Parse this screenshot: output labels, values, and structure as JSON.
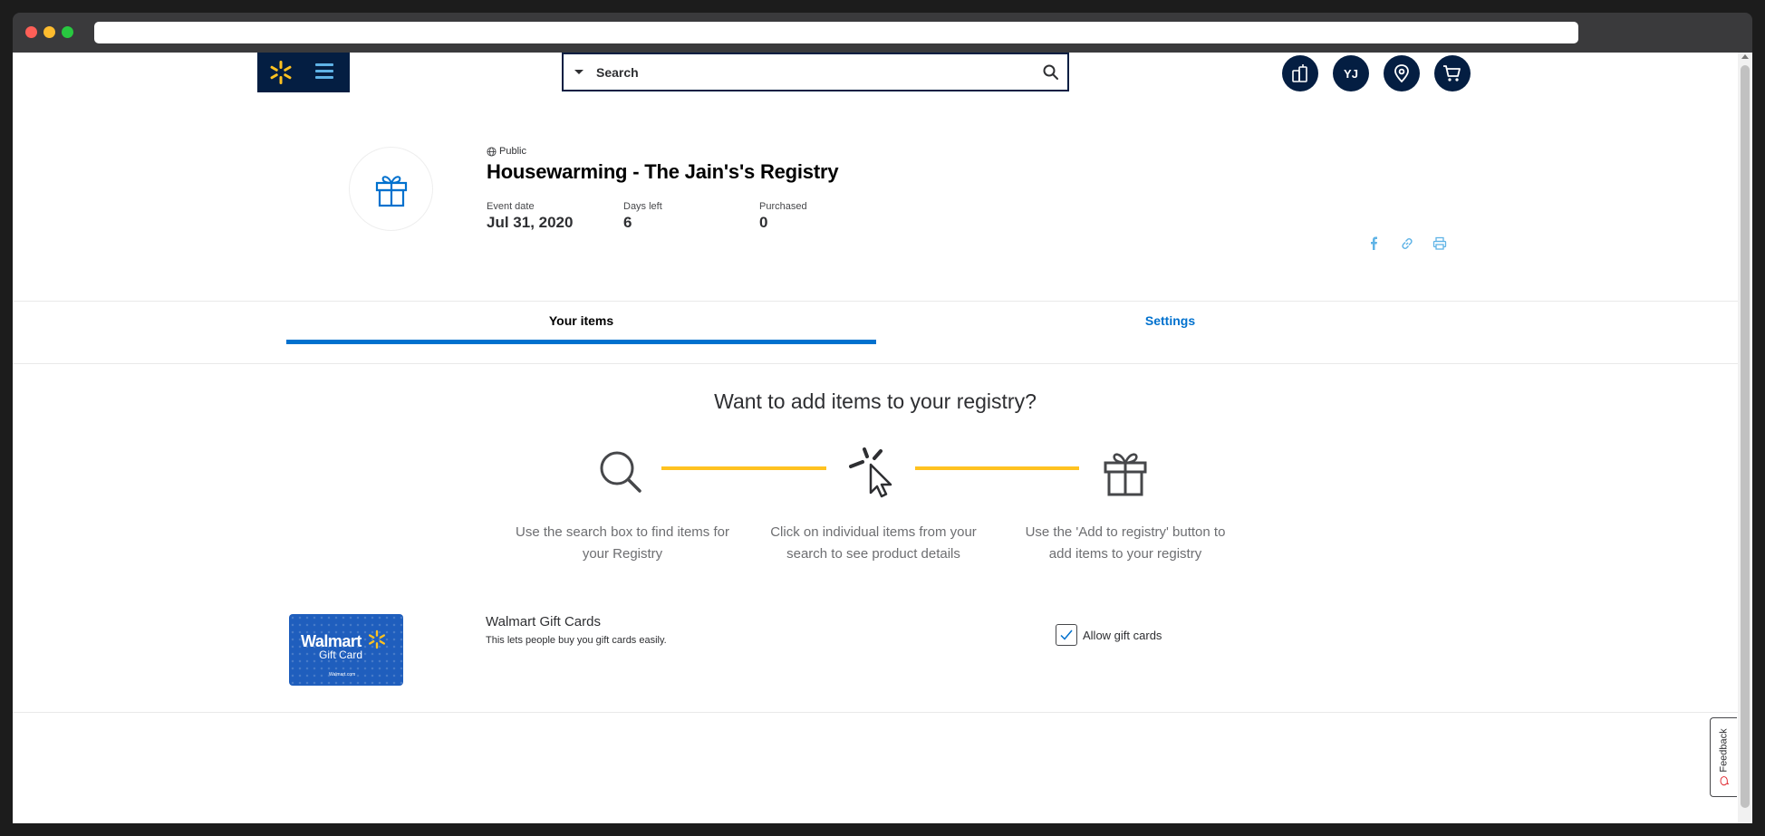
{
  "header": {
    "search_placeholder": "Search",
    "user_initials": "YJ",
    "icons": [
      "spark-logo-icon",
      "menu-icon",
      "search-icon",
      "registry-icon",
      "location-pin-icon",
      "cart-icon"
    ]
  },
  "registry": {
    "visibility": "Public",
    "title": "Housewarming - The Jain's's Registry",
    "stats": [
      {
        "label": "Event date",
        "value": "Jul 31, 2020"
      },
      {
        "label": "Days left",
        "value": "6"
      },
      {
        "label": "Purchased",
        "value": "0"
      }
    ]
  },
  "tabs": [
    {
      "label": "Your items",
      "active": true
    },
    {
      "label": "Settings",
      "active": false
    }
  ],
  "howto": {
    "title": "Want to add items to your registry?",
    "steps": [
      {
        "text": "Use the search box to find items for your Registry",
        "icon": "search-icon"
      },
      {
        "text": "Click on individual items from your search to see product details",
        "icon": "click-cursor-icon"
      },
      {
        "text": "Use the 'Add to registry' button to add items to your registry",
        "icon": "gift-icon"
      }
    ]
  },
  "gift_cards": {
    "card_brand": "Walmart",
    "card_sub": "Gift Card",
    "card_tiny": "Walmart.com",
    "title": "Walmart Gift Cards",
    "description": "This lets people buy you gift cards easily.",
    "checkbox_label": "Allow gift cards",
    "checked": true
  },
  "feedback": {
    "label": "Feedback"
  },
  "colors": {
    "navy": "#041e42",
    "blue": "#0071ce",
    "yellow": "#ffc220"
  }
}
